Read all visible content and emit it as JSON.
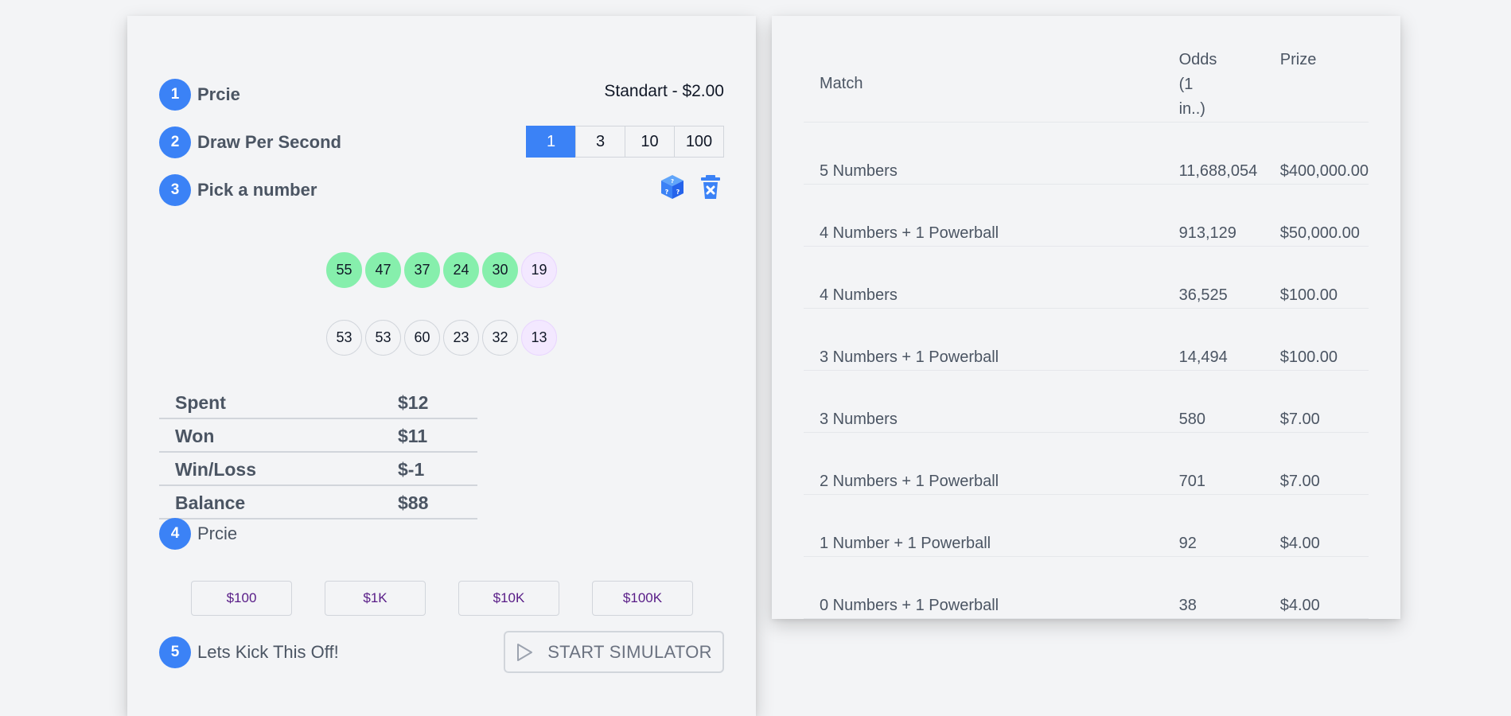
{
  "steps": {
    "step1": {
      "number": "1",
      "label": "Prcie",
      "value": "Standart - $2.00"
    },
    "step2": {
      "number": "2",
      "label": "Draw Per Second",
      "options": [
        "1",
        "3",
        "10",
        "100"
      ],
      "selected": "1"
    },
    "step3": {
      "number": "3",
      "label": "Pick a number"
    },
    "step4": {
      "number": "4",
      "label": "Prcie",
      "options": [
        "$100",
        "$1K",
        "$10K",
        "$100K"
      ]
    },
    "step5": {
      "number": "5",
      "label": "Lets Kick This Off!",
      "button": "START SIMULATOR"
    }
  },
  "draw": {
    "row1": [
      "55",
      "47",
      "37",
      "24",
      "30",
      "19"
    ],
    "row2": [
      "53",
      "53",
      "60",
      "23",
      "32",
      "13"
    ]
  },
  "stats": [
    {
      "label": "Spent",
      "value": "$12"
    },
    {
      "label": "Won",
      "value": "$11"
    },
    {
      "label": "Win/Loss",
      "value": "$-1"
    },
    {
      "label": "Balance",
      "value": "$88"
    }
  ],
  "prize_table": {
    "headers": {
      "match": "Match",
      "odds_line1": "Odds",
      "odds_line2": "(1",
      "odds_line3": "in..)",
      "prize": "Prize"
    },
    "rows": [
      {
        "match": "5 Numbers",
        "odds": "11,688,054",
        "prize": "$400,000.00"
      },
      {
        "match": "4 Numbers + 1 Powerball",
        "odds": "913,129",
        "prize": "$50,000.00"
      },
      {
        "match": "4 Numbers",
        "odds": "36,525",
        "prize": "$100.00"
      },
      {
        "match": "3 Numbers + 1 Powerball",
        "odds": "14,494",
        "prize": "$100.00"
      },
      {
        "match": "3 Numbers",
        "odds": "580",
        "prize": "$7.00"
      },
      {
        "match": "2 Numbers + 1 Powerball",
        "odds": "701",
        "prize": "$7.00"
      },
      {
        "match": "1 Number + 1 Powerball",
        "odds": "92",
        "prize": "$4.00"
      },
      {
        "match": "0 Numbers + 1 Powerball",
        "odds": "38",
        "prize": "$4.00"
      }
    ]
  },
  "icons": {
    "random": "dice-icon",
    "clear": "trash-icon",
    "play": "play-icon"
  },
  "colors": {
    "accent": "#3b82f6",
    "match_ball": "#86efac",
    "powerball": "#f3e8ff",
    "budget_text": "#581c87"
  }
}
